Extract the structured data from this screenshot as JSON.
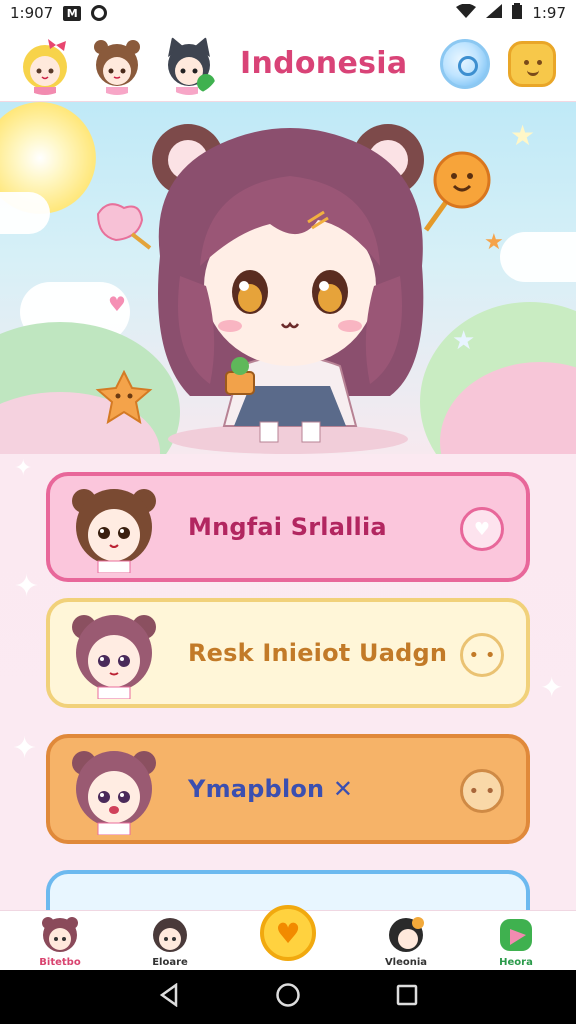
{
  "status_bar": {
    "time_left": "1:907",
    "time_right": "1:97",
    "icons": [
      "notification-box-icon",
      "notification-circle-icon",
      "wifi-icon",
      "signal-icon",
      "battery-icon"
    ]
  },
  "header": {
    "title": "Indonesia",
    "avatars": [
      "avatar-blonde-girl",
      "avatar-brown-bear-girl",
      "avatar-cat-ear-girl"
    ],
    "buttons": [
      "bubble-icon",
      "cookie-face-icon"
    ]
  },
  "cards": [
    {
      "title": "Mngfai Srlallia",
      "style": "pink",
      "action_icon": "heart-icon",
      "action_glyph": "♥"
    },
    {
      "title": "Resk Inieiot Uadgn",
      "style": "cream",
      "action_icon": "smile-icon",
      "action_glyph": "• •"
    },
    {
      "title": "Ymapblon",
      "title_suffix": "✕",
      "style": "orange",
      "action_icon": "cookie-icon",
      "action_glyph": "• •"
    },
    {
      "title": "",
      "style": "blue",
      "action_icon": "",
      "action_glyph": ""
    }
  ],
  "bottom_nav": {
    "items": [
      {
        "label": "Bitetbo",
        "color": "#d9436f"
      },
      {
        "label": "Eloare",
        "color": "#333333"
      },
      {
        "label": "Vleonia",
        "color": "#333333"
      },
      {
        "label": "Heora",
        "color": "#2a9a4a"
      }
    ],
    "center_glyph": "♥"
  },
  "colors": {
    "brand": "#d94377",
    "pink_card": "#fbc6dc",
    "cream_card": "#fff6d8",
    "orange_card": "#f6b368",
    "blue_card": "#e8f6ff"
  }
}
